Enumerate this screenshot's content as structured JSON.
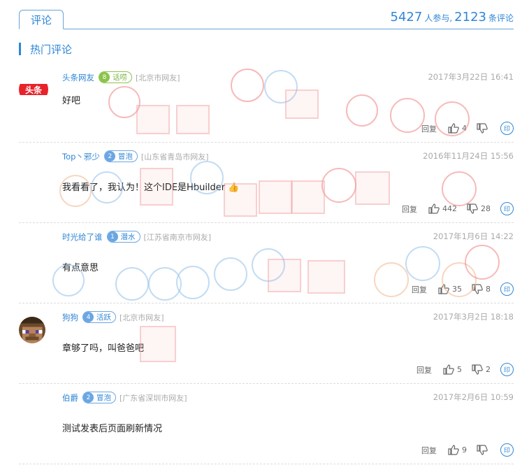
{
  "header": {
    "tab_label": "评论",
    "participants": "5427",
    "participants_suffix": "人参与,",
    "comment_count": "2123",
    "comment_suffix": "条评论"
  },
  "section_title": "热门评论",
  "actions": {
    "reply_label": "回复",
    "share_glyph": "印"
  },
  "comments": [
    {
      "user": "头条网友",
      "badge": "话唠",
      "level": "8",
      "location": "[北京市网友]",
      "time": "2017年3月22日 16:41",
      "text": "好吧",
      "likes": "4",
      "dislikes": ""
    },
    {
      "user": "Top丶邪少",
      "badge": "冒泡",
      "level": "2",
      "location": "[山东省青岛市网友]",
      "time": "2016年11月24日 15:56",
      "text": "我看看了，我认为！这个IDE是Hbuilder",
      "likes": "442",
      "dislikes": "28"
    },
    {
      "user": "时光给了谁",
      "badge": "潜水",
      "level": "1",
      "location": "[江苏省南京市网友]",
      "time": "2017年1月6日 14:22",
      "text": "有点意思",
      "likes": "35",
      "dislikes": "8"
    },
    {
      "user": "狗狗",
      "badge": "活跃",
      "level": "4",
      "location": "[北京市网友]",
      "time": "2017年3月2日 18:18",
      "text": "章够了吗，叫爸爸吧",
      "likes": "5",
      "dislikes": "2"
    },
    {
      "user": "伯爵",
      "badge": "冒泡",
      "level": "2",
      "location": "[广东省深圳市网友]",
      "time": "2017年2月6日 10:59",
      "text": "测试发表后页面刷新情况",
      "likes": "9",
      "dislikes": ""
    }
  ],
  "colors": {
    "accent": "#2f86d6",
    "muted": "#aaaaaa",
    "badge_green": "#8bc34a",
    "brand_red": "#e8222a"
  },
  "avatar_logo_text": "头条"
}
